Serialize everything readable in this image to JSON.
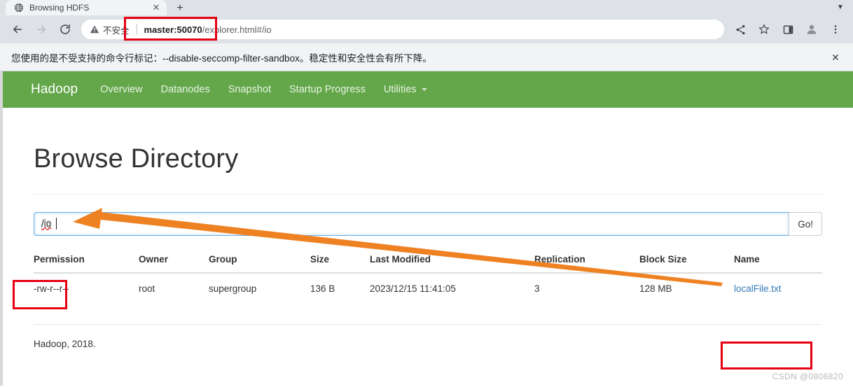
{
  "browser": {
    "tab": {
      "title": "Browsing HDFS",
      "favicon_icon": "globe-icon",
      "close_icon": "close-icon"
    },
    "new_tab_label": "+",
    "tab_list_icon": "chevron-down-icon",
    "nav": {
      "back_icon": "back-arrow-icon",
      "forward_icon": "forward-arrow-icon",
      "reload_icon": "reload-icon"
    },
    "omnibox": {
      "security_icon": "warning-triangle-icon",
      "security_label": "不安全",
      "url_host": "master:50070",
      "url_path": "/explorer.html#/io"
    },
    "actions": {
      "share_icon": "share-icon",
      "bookmark_icon": "star-icon",
      "side_panel_icon": "side-panel-icon",
      "profile_icon": "profile-avatar-icon",
      "menu_icon": "three-dot-menu-icon"
    },
    "infobar": {
      "message": "您使用的是不受支持的命令行标记：--disable-seccomp-filter-sandbox。稳定性和安全性会有所下降。",
      "close_icon": "close-icon"
    }
  },
  "page": {
    "navbar": {
      "brand": "Hadoop",
      "links": [
        {
          "label": "Overview"
        },
        {
          "label": "Datanodes"
        },
        {
          "label": "Snapshot"
        },
        {
          "label": "Startup Progress"
        },
        {
          "label": "Utilities",
          "caret": true
        }
      ]
    },
    "title": "Browse Directory",
    "path_form": {
      "value": "/io",
      "placeholder": "",
      "submit_label": "Go!"
    },
    "table": {
      "headers": [
        "Permission",
        "Owner",
        "Group",
        "Size",
        "Last Modified",
        "Replication",
        "Block Size",
        "Name"
      ],
      "rows": [
        {
          "permission": "-rw-r--r--",
          "owner": "root",
          "group": "supergroup",
          "size": "136 B",
          "last_modified": "2023/12/15 11:41:05",
          "replication": "3",
          "block_size": "128 MB",
          "name": "localFile.txt"
        }
      ]
    },
    "footer": "Hadoop, 2018."
  },
  "annotations": {
    "highlight_color": "#e60012",
    "arrow_color": "#ee8122",
    "watermark": "CSDN @0806820"
  }
}
